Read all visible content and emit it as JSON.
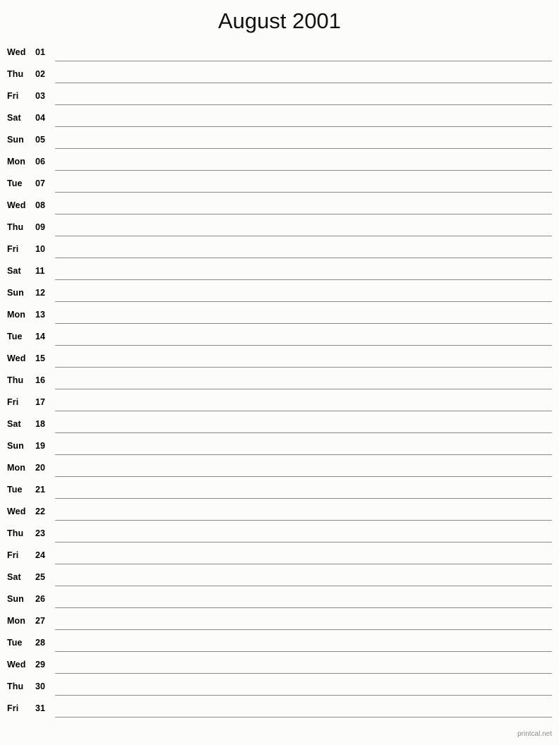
{
  "document": {
    "title": "August 2001",
    "month_name": "August",
    "year": "2001",
    "background_color": "#fcfdfa",
    "rule_color": "#8a8a8a",
    "text_color": "#000000"
  },
  "footer": {
    "credit": "printcal.net",
    "color": "#8c8c8c"
  },
  "days": [
    {
      "dow": "Wed",
      "dom": "01"
    },
    {
      "dow": "Thu",
      "dom": "02"
    },
    {
      "dow": "Fri",
      "dom": "03"
    },
    {
      "dow": "Sat",
      "dom": "04"
    },
    {
      "dow": "Sun",
      "dom": "05"
    },
    {
      "dow": "Mon",
      "dom": "06"
    },
    {
      "dow": "Tue",
      "dom": "07"
    },
    {
      "dow": "Wed",
      "dom": "08"
    },
    {
      "dow": "Thu",
      "dom": "09"
    },
    {
      "dow": "Fri",
      "dom": "10"
    },
    {
      "dow": "Sat",
      "dom": "11"
    },
    {
      "dow": "Sun",
      "dom": "12"
    },
    {
      "dow": "Mon",
      "dom": "13"
    },
    {
      "dow": "Tue",
      "dom": "14"
    },
    {
      "dow": "Wed",
      "dom": "15"
    },
    {
      "dow": "Thu",
      "dom": "16"
    },
    {
      "dow": "Fri",
      "dom": "17"
    },
    {
      "dow": "Sat",
      "dom": "18"
    },
    {
      "dow": "Sun",
      "dom": "19"
    },
    {
      "dow": "Mon",
      "dom": "20"
    },
    {
      "dow": "Tue",
      "dom": "21"
    },
    {
      "dow": "Wed",
      "dom": "22"
    },
    {
      "dow": "Thu",
      "dom": "23"
    },
    {
      "dow": "Fri",
      "dom": "24"
    },
    {
      "dow": "Sat",
      "dom": "25"
    },
    {
      "dow": "Sun",
      "dom": "26"
    },
    {
      "dow": "Mon",
      "dom": "27"
    },
    {
      "dow": "Tue",
      "dom": "28"
    },
    {
      "dow": "Wed",
      "dom": "29"
    },
    {
      "dow": "Thu",
      "dom": "30"
    },
    {
      "dow": "Fri",
      "dom": "31"
    }
  ]
}
